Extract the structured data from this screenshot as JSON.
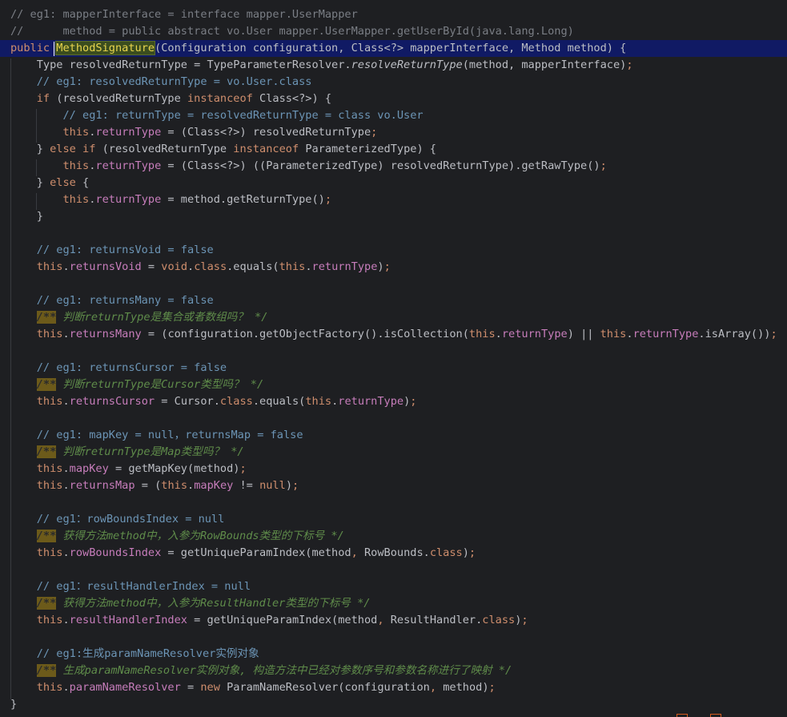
{
  "editor": {
    "language": "java",
    "lines": [
      {
        "tokens": [
          [
            "comment",
            "// eg1: mapperInterface = interface mapper.UserMapper"
          ]
        ]
      },
      {
        "tokens": [
          [
            "comment",
            "//      method = public abstract vo.User mapper.UserMapper.getUserById(java.lang.Long)"
          ]
        ]
      },
      {
        "highlight": true,
        "tokens": [
          [
            "kw",
            "public "
          ],
          [
            "method-hl",
            "MethodSignature"
          ],
          [
            "plain",
            "(Configuration configuration, Class<?> mapperInterface, Method method) {"
          ]
        ]
      },
      {
        "tokens": [
          [
            "plain",
            "    Type resolvedReturnType = TypeParameterResolver."
          ],
          [
            "static-call",
            "resolveReturnType"
          ],
          [
            "plain",
            "(method, mapperInterface)"
          ],
          [
            "kw",
            ";"
          ]
        ]
      },
      {
        "tokens": [
          [
            "cmt-blue",
            "    // eg1: resolvedReturnType = vo.User.class"
          ]
        ]
      },
      {
        "tokens": [
          [
            "kw",
            "    if "
          ],
          [
            "plain",
            "(resolvedReturnType "
          ],
          [
            "kw",
            "instanceof "
          ],
          [
            "plain",
            "Class<?>) {"
          ]
        ]
      },
      {
        "tokens": [
          [
            "cmt-blue",
            "        // eg1: returnType = resolvedReturnType = class vo.User"
          ]
        ]
      },
      {
        "tokens": [
          [
            "kw",
            "        this"
          ],
          [
            "plain",
            "."
          ],
          [
            "field",
            "returnType"
          ],
          [
            "plain",
            " = (Class<?>) resolvedReturnType"
          ],
          [
            "kw",
            ";"
          ]
        ]
      },
      {
        "tokens": [
          [
            "plain",
            "    } "
          ],
          [
            "kw",
            "else if "
          ],
          [
            "plain",
            "(resolvedReturnType "
          ],
          [
            "kw",
            "instanceof "
          ],
          [
            "plain",
            "ParameterizedType) {"
          ]
        ]
      },
      {
        "tokens": [
          [
            "kw",
            "        this"
          ],
          [
            "plain",
            "."
          ],
          [
            "field",
            "returnType"
          ],
          [
            "plain",
            " = (Class<?>) ((ParameterizedType) resolvedReturnType).getRawType()"
          ],
          [
            "kw",
            ";"
          ]
        ]
      },
      {
        "tokens": [
          [
            "plain",
            "    } "
          ],
          [
            "kw",
            "else "
          ],
          [
            "plain",
            "{"
          ]
        ]
      },
      {
        "tokens": [
          [
            "kw",
            "        this"
          ],
          [
            "plain",
            "."
          ],
          [
            "field",
            "returnType"
          ],
          [
            "plain",
            " = method.getReturnType()"
          ],
          [
            "kw",
            ";"
          ]
        ]
      },
      {
        "tokens": [
          [
            "plain",
            "    }"
          ]
        ]
      },
      {
        "tokens": []
      },
      {
        "tokens": [
          [
            "cmt-blue",
            "    // eg1: returnsVoid = false"
          ]
        ]
      },
      {
        "tokens": [
          [
            "kw",
            "    this"
          ],
          [
            "plain",
            "."
          ],
          [
            "field",
            "returnsVoid"
          ],
          [
            "plain",
            " = "
          ],
          [
            "kw",
            "void"
          ],
          [
            "plain",
            "."
          ],
          [
            "kw",
            "class"
          ],
          [
            "plain",
            ".equals("
          ],
          [
            "kw",
            "this"
          ],
          [
            "plain",
            "."
          ],
          [
            "field",
            "returnType"
          ],
          [
            "plain",
            ")"
          ],
          [
            "kw",
            ";"
          ]
        ]
      },
      {
        "tokens": []
      },
      {
        "tokens": [
          [
            "cmt-blue",
            "    // eg1: returnsMany = false"
          ]
        ]
      },
      {
        "tokens": [
          [
            "plain",
            "    "
          ],
          [
            "doc-mark",
            "/**"
          ],
          [
            "doc",
            " 判断returnType是集合或者数组吗？ */"
          ]
        ]
      },
      {
        "tokens": [
          [
            "kw",
            "    this"
          ],
          [
            "plain",
            "."
          ],
          [
            "field",
            "returnsMany"
          ],
          [
            "plain",
            " = (configuration.getObjectFactory().isCollection("
          ],
          [
            "kw",
            "this"
          ],
          [
            "plain",
            "."
          ],
          [
            "field",
            "returnType"
          ],
          [
            "plain",
            ") || "
          ],
          [
            "kw",
            "this"
          ],
          [
            "plain",
            "."
          ],
          [
            "field",
            "returnType"
          ],
          [
            "plain",
            ".isArray())"
          ],
          [
            "kw",
            ";"
          ]
        ]
      },
      {
        "tokens": []
      },
      {
        "tokens": [
          [
            "cmt-blue",
            "    // eg1: returnsCursor = false"
          ]
        ]
      },
      {
        "tokens": [
          [
            "plain",
            "    "
          ],
          [
            "doc-mark",
            "/**"
          ],
          [
            "doc",
            " 判断returnType是Cursor类型吗？ */"
          ]
        ]
      },
      {
        "tokens": [
          [
            "kw",
            "    this"
          ],
          [
            "plain",
            "."
          ],
          [
            "field",
            "returnsCursor"
          ],
          [
            "plain",
            " = Cursor."
          ],
          [
            "kw",
            "class"
          ],
          [
            "plain",
            ".equals("
          ],
          [
            "kw",
            "this"
          ],
          [
            "plain",
            "."
          ],
          [
            "field",
            "returnType"
          ],
          [
            "plain",
            ")"
          ],
          [
            "kw",
            ";"
          ]
        ]
      },
      {
        "tokens": []
      },
      {
        "tokens": [
          [
            "cmt-blue",
            "    // eg1: mapKey = null，returnsMap = false"
          ]
        ]
      },
      {
        "tokens": [
          [
            "plain",
            "    "
          ],
          [
            "doc-mark",
            "/**"
          ],
          [
            "doc",
            " 判断returnType是Map类型吗？ */"
          ]
        ]
      },
      {
        "tokens": [
          [
            "kw",
            "    this"
          ],
          [
            "plain",
            "."
          ],
          [
            "field",
            "mapKey"
          ],
          [
            "plain",
            " = getMapKey(method)"
          ],
          [
            "kw",
            ";"
          ]
        ]
      },
      {
        "tokens": [
          [
            "kw",
            "    this"
          ],
          [
            "plain",
            "."
          ],
          [
            "field",
            "returnsMap"
          ],
          [
            "plain",
            " = ("
          ],
          [
            "kw",
            "this"
          ],
          [
            "plain",
            "."
          ],
          [
            "field",
            "mapKey"
          ],
          [
            "plain",
            " != "
          ],
          [
            "kw",
            "null"
          ],
          [
            "plain",
            ")"
          ],
          [
            "kw",
            ";"
          ]
        ]
      },
      {
        "tokens": []
      },
      {
        "tokens": [
          [
            "cmt-blue",
            "    // eg1：rowBoundsIndex = null"
          ]
        ]
      },
      {
        "tokens": [
          [
            "plain",
            "    "
          ],
          [
            "doc-mark",
            "/**"
          ],
          [
            "doc",
            " 获得方法method中，入参为RowBounds类型的下标号 */"
          ]
        ]
      },
      {
        "tokens": [
          [
            "kw",
            "    this"
          ],
          [
            "plain",
            "."
          ],
          [
            "field",
            "rowBoundsIndex"
          ],
          [
            "plain",
            " = getUniqueParamIndex(method"
          ],
          [
            "kw",
            ", "
          ],
          [
            "plain",
            "RowBounds."
          ],
          [
            "kw",
            "class"
          ],
          [
            "plain",
            ")"
          ],
          [
            "kw",
            ";"
          ]
        ]
      },
      {
        "tokens": []
      },
      {
        "tokens": [
          [
            "cmt-blue",
            "    // eg1：resultHandlerIndex = null"
          ]
        ]
      },
      {
        "tokens": [
          [
            "plain",
            "    "
          ],
          [
            "doc-mark",
            "/**"
          ],
          [
            "doc",
            " 获得方法method中，入参为ResultHandler类型的下标号 */"
          ]
        ]
      },
      {
        "tokens": [
          [
            "kw",
            "    this"
          ],
          [
            "plain",
            "."
          ],
          [
            "field",
            "resultHandlerIndex"
          ],
          [
            "plain",
            " = getUniqueParamIndex(method"
          ],
          [
            "kw",
            ", "
          ],
          [
            "plain",
            "ResultHandler."
          ],
          [
            "kw",
            "class"
          ],
          [
            "plain",
            ")"
          ],
          [
            "kw",
            ";"
          ]
        ]
      },
      {
        "tokens": []
      },
      {
        "tokens": [
          [
            "cmt-blue",
            "    // eg1:生成paramNameResolver实例对象"
          ]
        ]
      },
      {
        "tokens": [
          [
            "plain",
            "    "
          ],
          [
            "doc-mark",
            "/**"
          ],
          [
            "doc",
            " 生成paramNameResolver实例对象, 构造方法中已经对参数序号和参数名称进行了映射 */"
          ]
        ]
      },
      {
        "tokens": [
          [
            "kw",
            "    this"
          ],
          [
            "plain",
            "."
          ],
          [
            "field",
            "paramNameResolver"
          ],
          [
            "plain",
            " = "
          ],
          [
            "kw",
            "new "
          ],
          [
            "plain",
            "ParamNameResolver(configuration"
          ],
          [
            "kw",
            ", "
          ],
          [
            "plain",
            "method)"
          ],
          [
            "kw",
            ";"
          ]
        ]
      },
      {
        "tokens": [
          [
            "plain",
            "}"
          ]
        ]
      }
    ]
  }
}
